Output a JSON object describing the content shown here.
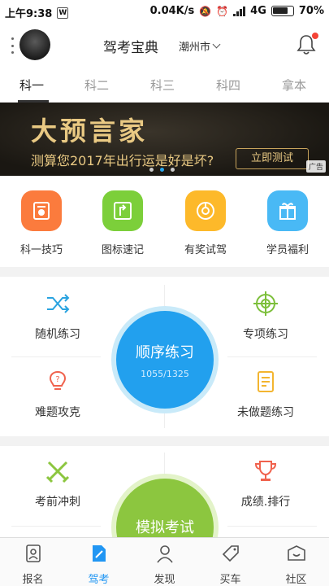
{
  "status_bar": {
    "time": "上午9:38",
    "network_speed": "0.04K/s",
    "network_type": "4G",
    "battery": "70%"
  },
  "header": {
    "title": "驾考宝典",
    "city": "潮州市"
  },
  "tabs": [
    {
      "label": "科一",
      "active": true
    },
    {
      "label": "科二",
      "active": false
    },
    {
      "label": "科三",
      "active": false
    },
    {
      "label": "科四",
      "active": false
    },
    {
      "label": "拿本",
      "active": false
    }
  ],
  "banner": {
    "title": "大预言家",
    "subtitle": "测算您2017年出行运是好是坏?",
    "button": "立即测试",
    "ad_tag": "广告",
    "active_dot": 1
  },
  "quick_links": [
    {
      "label": "科一技巧",
      "icon": "tips-icon",
      "color": "#fb7b3d"
    },
    {
      "label": "图标速记",
      "icon": "sign-icon",
      "color": "#7ccf3a"
    },
    {
      "label": "有奖试驾",
      "icon": "steering-wheel-icon",
      "color": "#fdb92a"
    },
    {
      "label": "学员福利",
      "icon": "gift-icon",
      "color": "#49b9f5"
    }
  ],
  "practice": {
    "random": "随机练习",
    "special": "专项练习",
    "difficult": "难题攻克",
    "undone": "未做题练习",
    "sequential": {
      "title": "顺序练习",
      "count": "1055/1325"
    }
  },
  "exam": {
    "sprint": "考前冲刺",
    "ranking": "成绩.排行",
    "mock": "模拟考试"
  },
  "bottom_nav": [
    {
      "label": "报名",
      "icon": "signup-icon",
      "active": false
    },
    {
      "label": "驾考",
      "icon": "driving-exam-icon",
      "active": true
    },
    {
      "label": "发现",
      "icon": "discover-icon",
      "active": false
    },
    {
      "label": "买车",
      "icon": "buy-car-icon",
      "active": false
    },
    {
      "label": "社区",
      "icon": "community-icon",
      "active": false
    }
  ],
  "colors": {
    "accent_blue": "#22a0ee",
    "accent_green": "#8cc63f",
    "banner_gold": "#e9c983",
    "notification_red": "#f44336"
  }
}
